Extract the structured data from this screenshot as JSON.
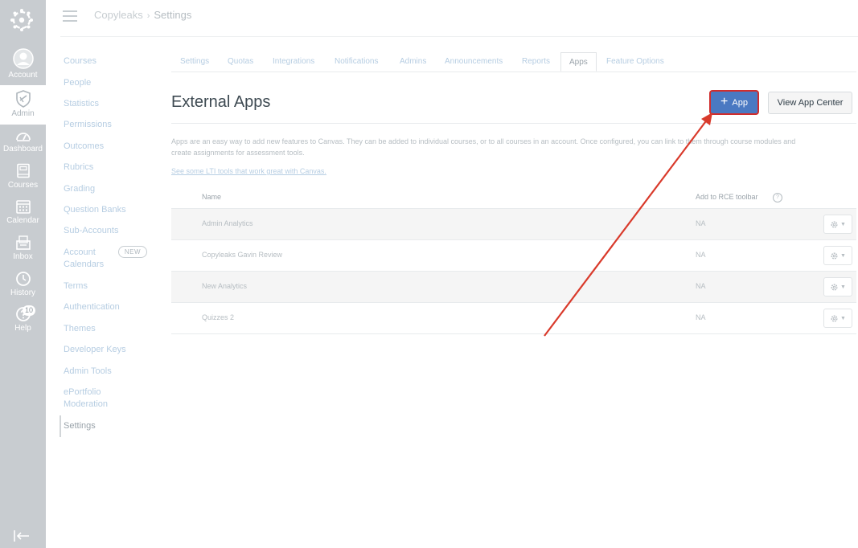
{
  "global_nav": {
    "items": [
      {
        "label": "Account",
        "icon": "avatar-icon"
      },
      {
        "label": "Admin",
        "icon": "shield-icon"
      },
      {
        "label": "Dashboard",
        "icon": "dashboard-icon"
      },
      {
        "label": "Courses",
        "icon": "book-icon"
      },
      {
        "label": "Calendar",
        "icon": "calendar-icon"
      },
      {
        "label": "Inbox",
        "icon": "inbox-icon"
      },
      {
        "label": "History",
        "icon": "clock-icon"
      },
      {
        "label": "Help",
        "icon": "help-icon",
        "badge": "10"
      }
    ]
  },
  "header": {
    "breadcrumb": [
      "Copyleaks",
      "Settings"
    ]
  },
  "subnav": {
    "items": [
      "Courses",
      "People",
      "Statistics",
      "Permissions",
      "Outcomes",
      "Rubrics",
      "Grading",
      "Question Banks",
      "Sub-Accounts",
      "Account",
      "Calendars",
      "Terms",
      "Authentication",
      "Themes",
      "Developer Keys",
      "Admin Tools",
      "ePortfolio",
      "Moderation",
      "Settings"
    ],
    "new_badge": "NEW"
  },
  "tabs": [
    "Settings",
    "Quotas",
    "Integrations",
    "Notifications",
    "Admins",
    "Announcements",
    "Reports",
    "Apps",
    "Feature Options"
  ],
  "main": {
    "title": "External Apps",
    "add_button": "App",
    "app_center_button": "View App Center",
    "description_1": "Apps are an easy way to add new features to Canvas. They can be added to individual courses, or to all courses in an account. Once configured, you can link to them through course modules and",
    "description_2": "create assignments for assessment tools.",
    "lti_link": "See some LTI tools that work great with Canvas."
  },
  "table": {
    "headers": [
      "Name",
      "Add to RCE toolbar"
    ],
    "help_glyph": "?",
    "rows": [
      {
        "name": "Admin Analytics",
        "rce": "NA"
      },
      {
        "name": "Copyleaks Gavin Review",
        "rce": "NA"
      },
      {
        "name": "New Analytics",
        "rce": "NA"
      },
      {
        "name": "Quizzes 2",
        "rce": "NA"
      }
    ]
  },
  "colors": {
    "nav_bg": "#c8ccd0",
    "primary_button": "#4a79c2",
    "highlight_red": "#d02d2d"
  }
}
